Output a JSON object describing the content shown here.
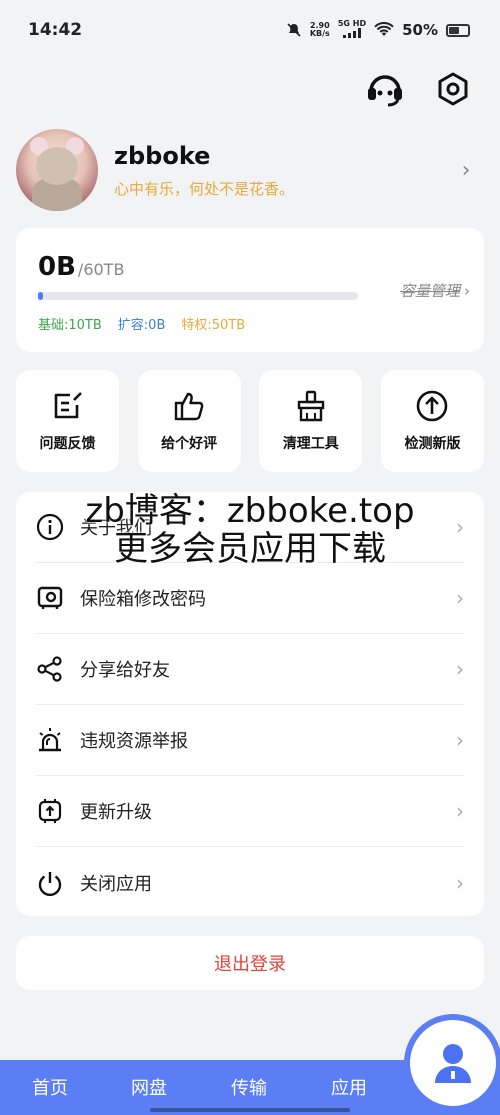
{
  "status_bar": {
    "time": "14:42",
    "net_speed_value": "2.90",
    "net_speed_unit": "KB/s",
    "network_badge_top": "5G",
    "network_badge_hd": "HD",
    "battery_percent": "50%",
    "battery_level": 0.5
  },
  "profile": {
    "username": "zbboke",
    "motto": "心中有乐，何处不是花香。"
  },
  "storage": {
    "used": "0B",
    "total": "/60TB",
    "used_fraction": 0.015,
    "manage_label": "容量管理",
    "quota_base": "基础:10TB",
    "quota_expand": "扩容:0B",
    "quota_privilege": "特权:50TB"
  },
  "tiles": [
    {
      "label": "问题反馈",
      "icon": "feedback-icon"
    },
    {
      "label": "给个好评",
      "icon": "thumbs-up-icon"
    },
    {
      "label": "清理工具",
      "icon": "broom-icon"
    },
    {
      "label": "检测新版",
      "icon": "upload-arrow-icon"
    }
  ],
  "menu": [
    {
      "label": "关于我们",
      "icon": "info-icon"
    },
    {
      "label": "保险箱修改密码",
      "icon": "safe-icon"
    },
    {
      "label": "分享给好友",
      "icon": "share-icon"
    },
    {
      "label": "违规资源举报",
      "icon": "alarm-icon"
    },
    {
      "label": "更新升级",
      "icon": "upgrade-icon"
    },
    {
      "label": "关闭应用",
      "icon": "power-icon"
    }
  ],
  "watermark": {
    "line1": "zb博客：zbboke.top",
    "line2": "更多会员应用下载"
  },
  "logout_label": "退出登录",
  "tabbar": {
    "tab1": "首页",
    "tab2": "网盘",
    "tab3": "传输",
    "tab4": "应用"
  },
  "colors": {
    "accent": "#5b7ef5",
    "motto": "#e8a93a",
    "logout": "#e0443b"
  }
}
